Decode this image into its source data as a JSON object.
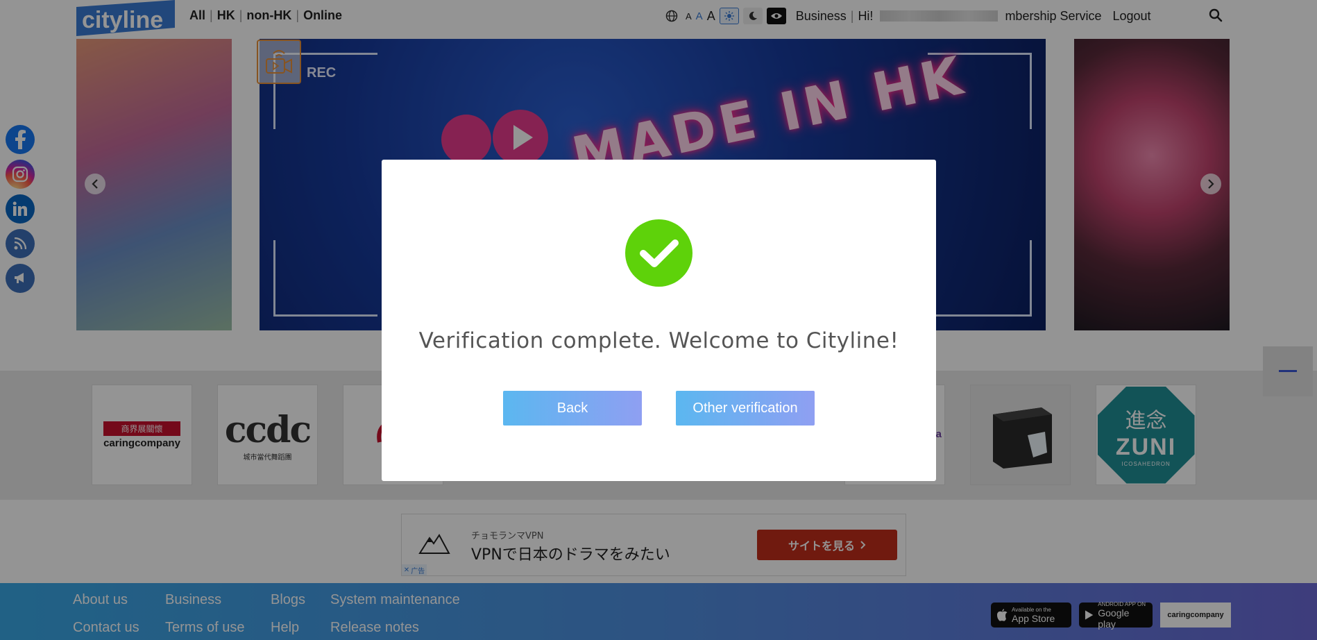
{
  "header": {
    "logo_text": "cityline",
    "nav": [
      "All",
      "HK",
      "non-HK",
      "Online"
    ],
    "font_sizes": [
      "A",
      "A",
      "A"
    ],
    "business_label": "Business",
    "greeting": "Hi!",
    "membership_label": "mbership Service",
    "logout_label": "Logout"
  },
  "banner": {
    "rec_label": "REC",
    "main_title": "MADE IN HK"
  },
  "partners": {
    "caring_line1": "商界展關懷",
    "caring_line2": "caringcompany",
    "ccdc_text": "ccdc",
    "ccdc_sub": "城市當代舞蹈團",
    "zuni_top": "進念",
    "zuni_main": "ZUNI",
    "zuni_sub": "ICOSAHEDRON"
  },
  "ad": {
    "brand": "チョモランマVPN",
    "headline": "VPNで日本のドラマをみたい",
    "cta": "サイトを見る",
    "badge": "广告"
  },
  "footer": {
    "links": [
      "About us",
      "Business",
      "Blogs",
      "System maintenance",
      "Contact us",
      "Terms of use",
      "Help",
      "Release notes"
    ],
    "app_store_small": "Available on the",
    "app_store": "App Store",
    "google_play_small": "ANDROID APP ON",
    "google_play": "Google play",
    "caring": "caringcompany"
  },
  "modal": {
    "message": "Verification complete. Welcome to Cityline!",
    "back_label": "Back",
    "other_label": "Other verification",
    "success_color": "#5ed20a"
  }
}
